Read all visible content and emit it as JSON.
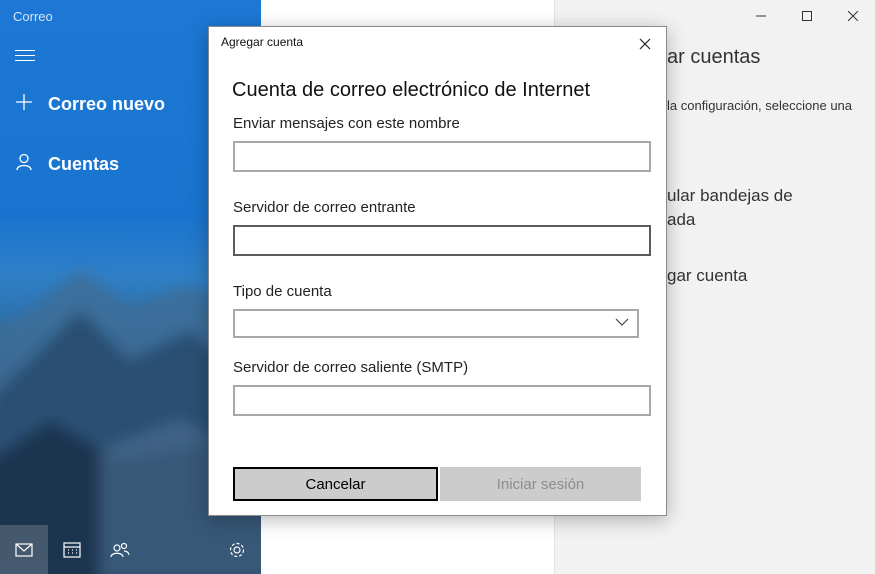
{
  "app": {
    "title": "Correo"
  },
  "sidebar": {
    "items": [
      {
        "label": "Correo nuevo",
        "icon": "plus-icon"
      },
      {
        "label": "Cuentas",
        "icon": "person-icon"
      }
    ],
    "bottom_icons": [
      "mail-icon",
      "calendar-icon",
      "people-icon",
      "settings-icon"
    ],
    "accent": "#1c78d4"
  },
  "right_pane": {
    "title": "ar cuentas",
    "description": "la configuración, seleccione una",
    "link1_line1": "ular bandejas de",
    "link1_line2": "ada",
    "link2": "gar cuenta"
  },
  "dialog": {
    "title": "Agregar cuenta",
    "heading": "Cuenta de correo electrónico de Internet",
    "fields": {
      "send_name": {
        "label": "Enviar mensajes con este nombre",
        "value": ""
      },
      "incoming_server": {
        "label": "Servidor de correo entrante",
        "value": ""
      },
      "account_type": {
        "label": "Tipo de cuenta",
        "value": ""
      },
      "outgoing_server": {
        "label": "Servidor de correo saliente (SMTP)",
        "value": ""
      }
    },
    "buttons": {
      "cancel": "Cancelar",
      "sign_in": "Iniciar sesión"
    }
  }
}
